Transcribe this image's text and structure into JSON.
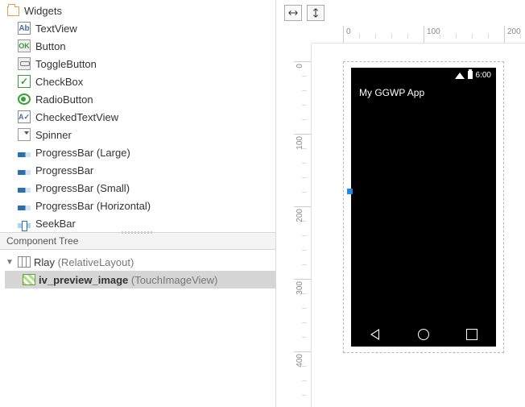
{
  "palette": {
    "group_label": "Widgets",
    "items": [
      {
        "label": "TextView",
        "icon": "ab-icon",
        "name": "textview"
      },
      {
        "label": "Button",
        "icon": "ok-icon",
        "name": "button"
      },
      {
        "label": "ToggleButton",
        "icon": "toggle-icon",
        "name": "togglebutton"
      },
      {
        "label": "CheckBox",
        "icon": "check-icon",
        "name": "checkbox"
      },
      {
        "label": "RadioButton",
        "icon": "radio-icon",
        "name": "radiobutton"
      },
      {
        "label": "CheckedTextView",
        "icon": "ctv-icon",
        "name": "checkedtextview"
      },
      {
        "label": "Spinner",
        "icon": "spinner-icon",
        "name": "spinner"
      },
      {
        "label": "ProgressBar (Large)",
        "icon": "pb-icon",
        "name": "progressbar-large"
      },
      {
        "label": "ProgressBar",
        "icon": "pb-icon",
        "name": "progressbar"
      },
      {
        "label": "ProgressBar (Small)",
        "icon": "pb-icon",
        "name": "progressbar-small"
      },
      {
        "label": "ProgressBar (Horizontal)",
        "icon": "pb-icon",
        "name": "progressbar-horizontal"
      },
      {
        "label": "SeekBar",
        "icon": "seek-icon",
        "name": "seekbar"
      }
    ]
  },
  "tree": {
    "title": "Component Tree",
    "root": {
      "name": "Rlay",
      "type": "RelativeLayout"
    },
    "child": {
      "name": "iv_preview_image",
      "type": "TouchImageView"
    }
  },
  "canvas": {
    "ruler_h": [
      "0",
      "100",
      "200"
    ],
    "ruler_v": [
      "0",
      "100",
      "200",
      "300",
      "400"
    ],
    "app_title": "My GGWP App",
    "status_time": "6:00"
  }
}
